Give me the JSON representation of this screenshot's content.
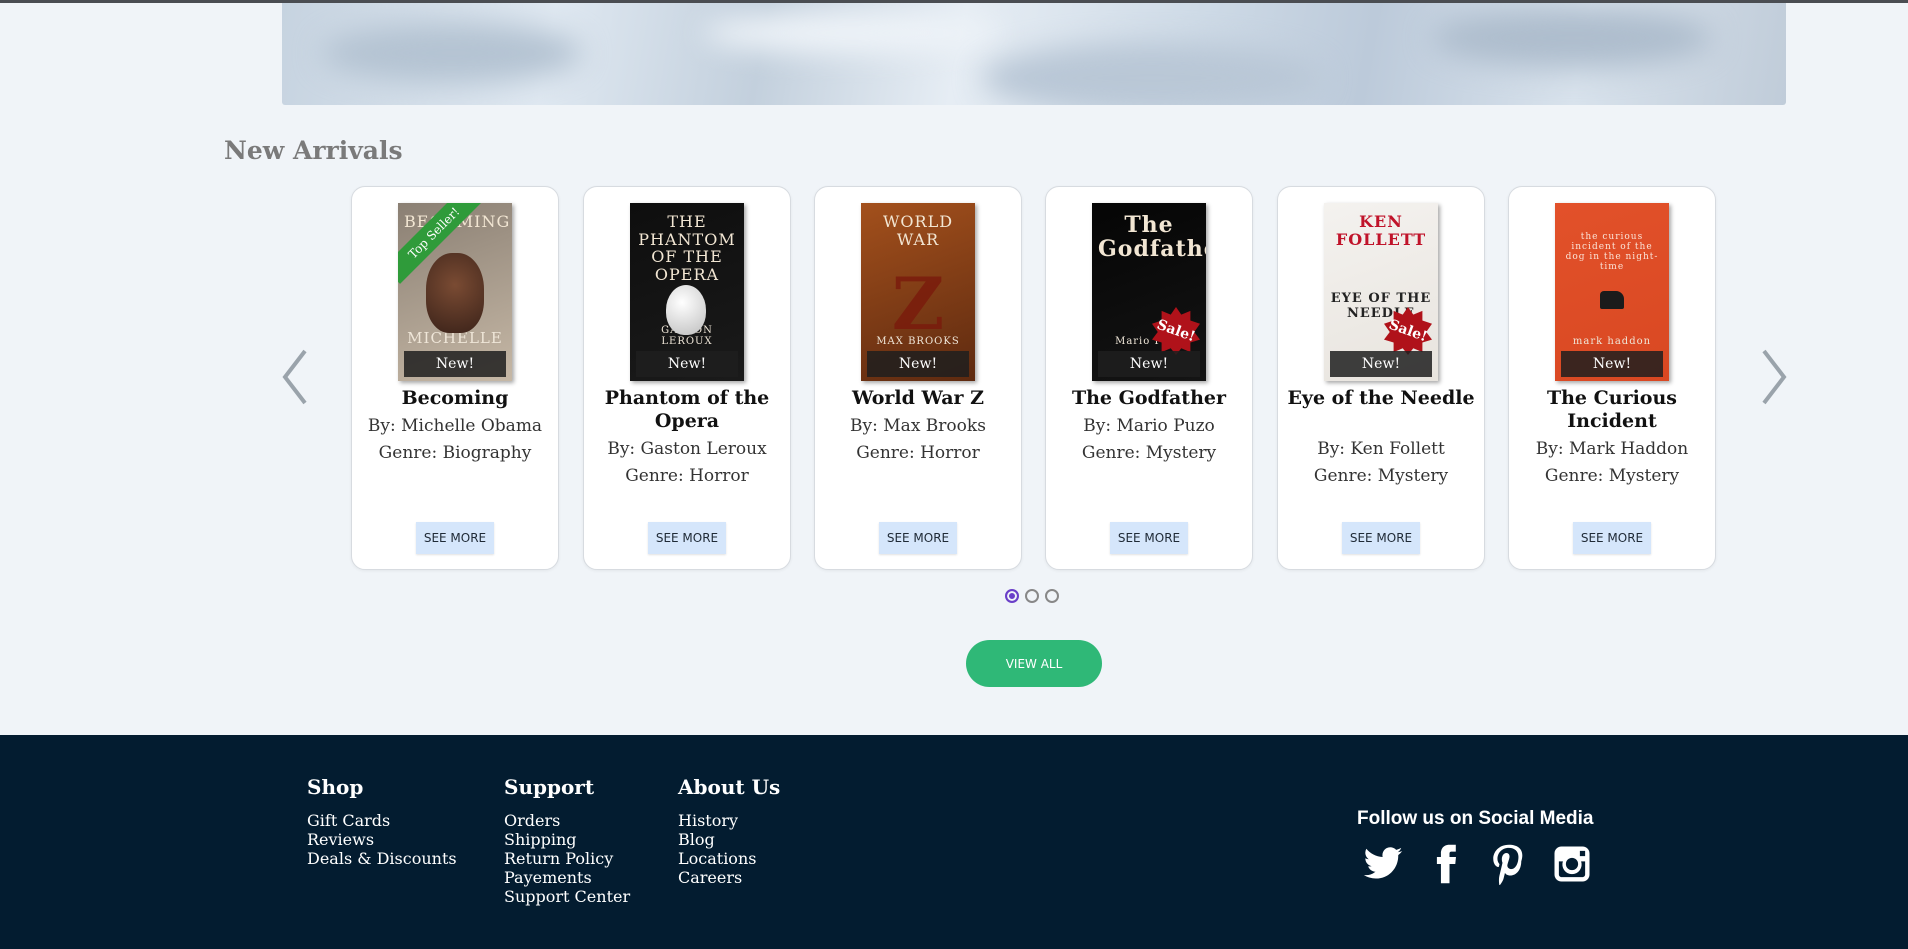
{
  "section": {
    "title": "New Arrivals"
  },
  "carousel": {
    "books": [
      {
        "title": "Becoming",
        "author": "By: Michelle Obama",
        "genre": "Genre: Biography",
        "badge": "New!",
        "ribbon": "Top Seller!",
        "sale": "",
        "cover_text_top": "BECOMING",
        "cover_text_bottom": "MICHELLE",
        "cover_colors": [
          "#8a7f73",
          "#c6b8a6"
        ]
      },
      {
        "title": "Phantom of the Opera",
        "author": "By: Gaston Leroux",
        "genre": "Genre: Horror",
        "badge": "New!",
        "ribbon": "",
        "sale": "",
        "cover_text_top": "THE PHANTOM OF THE OPERA",
        "cover_text_bottom": "GASTON LEROUX",
        "cover_colors": [
          "#0e0e0e",
          "#1a1a1a"
        ]
      },
      {
        "title": "World War Z",
        "author": "By: Max Brooks",
        "genre": "Genre: Horror",
        "badge": "New!",
        "ribbon": "",
        "sale": "",
        "cover_text_top": "WORLD WAR",
        "cover_text_bottom": "MAX BROOKS",
        "cover_colors": [
          "#a3501c",
          "#5e2a10"
        ]
      },
      {
        "title": "The Godfather",
        "author": "By: Mario Puzo",
        "genre": "Genre: Mystery",
        "badge": "New!",
        "ribbon": "",
        "sale": "Sale!",
        "cover_text_top": "The Godfather",
        "cover_text_bottom": "Mario Puzo",
        "cover_colors": [
          "#050505",
          "#141414"
        ]
      },
      {
        "title": "Eye of the Needle",
        "author": "By: Ken Follett",
        "genre": "Genre: Mystery",
        "badge": "New!",
        "ribbon": "",
        "sale": "Sale!",
        "cover_text_top": "KEN FOLLETT",
        "cover_text_bottom": "EYE OF THE NEEDLE",
        "cover_colors": [
          "#f4f2ef",
          "#e8e4de"
        ]
      },
      {
        "title": "The Curious Incident",
        "author": "By: Mark Haddon",
        "genre": "Genre: Mystery",
        "badge": "New!",
        "ribbon": "",
        "sale": "",
        "cover_text_top": "the curious incident of the dog in the night-time",
        "cover_text_bottom": "mark haddon",
        "cover_colors": [
          "#e2512a",
          "#d94822"
        ]
      }
    ],
    "see_more_label": "SEE MORE",
    "pagination": {
      "pages": 3,
      "active": 1
    },
    "prev_icon": "chevron-left-icon",
    "next_icon": "chevron-right-icon"
  },
  "view_all_label": "VIEW ALL",
  "footer": {
    "columns": [
      {
        "heading": "Shop",
        "links": [
          "Gift Cards",
          "Reviews",
          "Deals & Discounts"
        ]
      },
      {
        "heading": "Support",
        "links": [
          "Orders",
          "Shipping",
          "Return Policy",
          "Payements",
          "Support Center"
        ]
      },
      {
        "heading": "About Us",
        "links": [
          "History",
          "Blog",
          "Locations",
          "Careers"
        ]
      }
    ],
    "social_title": "Follow us on Social Media",
    "social_icons": [
      "twitter-icon",
      "facebook-icon",
      "pinterest-icon",
      "instagram-icon"
    ]
  },
  "colors": {
    "background": "#f0f4f8",
    "footer": "#031c30",
    "accent_green": "#2fb877",
    "button_blue": "#d5e6fb",
    "sale_red": "#b0121a",
    "ribbon_green": "#2f9b3a"
  }
}
